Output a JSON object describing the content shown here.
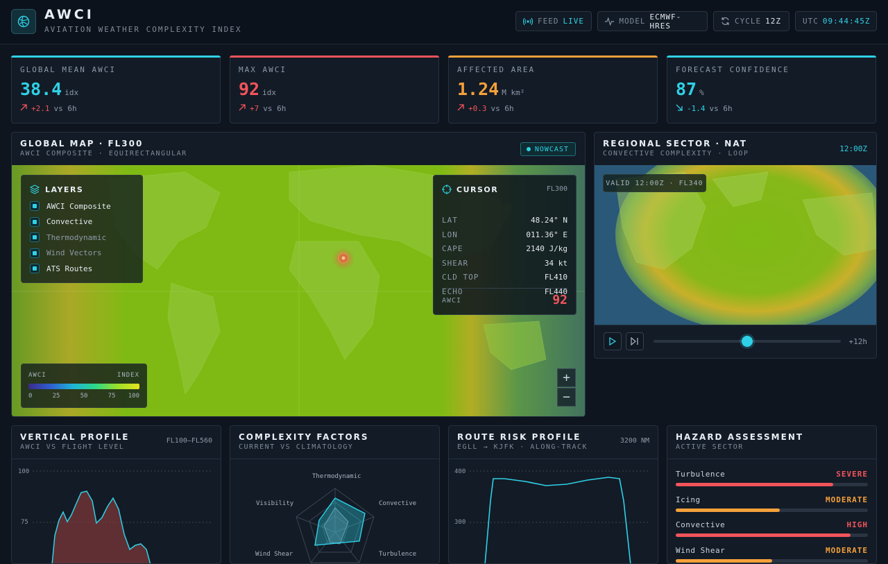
{
  "header": {
    "title": "AWCI",
    "subtitle": "AVIATION WEATHER COMPLEXITY INDEX",
    "feed": {
      "label": "FEED",
      "value": "LIVE"
    },
    "model": {
      "label": "MODEL",
      "value": "ECMWF-HRES"
    },
    "cycle": {
      "label": "CYCLE",
      "value": "12Z"
    },
    "utc": {
      "label": "UTC",
      "value": "09:44:45Z"
    }
  },
  "stats": [
    {
      "label": "GLOBAL MEAN AWCI",
      "value": "38.4",
      "unit": "idx",
      "delta": "+2.1",
      "suffix": "vs 6h",
      "color": "#2fd1e6",
      "delta_color": "#f2545b"
    },
    {
      "label": "MAX AWCI",
      "value": "92",
      "unit": "idx",
      "delta": "+7",
      "suffix": "vs 6h",
      "color": "#f2545b",
      "delta_color": "#f2545b"
    },
    {
      "label": "AFFECTED AREA",
      "value": "1.24",
      "unit": "M km²",
      "delta": "+0.3",
      "suffix": "vs 6h",
      "color": "#f5a03a",
      "delta_color": "#f2545b"
    },
    {
      "label": "FORECAST CONFIDENCE",
      "value": "87",
      "unit": "%",
      "delta": "-1.4",
      "suffix": "vs 6h",
      "color": "#2fd1e6",
      "delta_color": "#2fd1e6"
    }
  ],
  "map": {
    "title": "GLOBAL MAP · FL300",
    "subtitle": "AWCI COMPOSITE · EQUIRECTANGULAR",
    "badge": "NOWCAST",
    "layers_title": "LAYERS",
    "layers": [
      {
        "label": "AWCI Composite",
        "on": true
      },
      {
        "label": "Convective",
        "on": true
      },
      {
        "label": "Thermodynamic",
        "on": false
      },
      {
        "label": "Wind Vectors",
        "on": false
      },
      {
        "label": "ATS Routes",
        "on": true
      }
    ],
    "legend": {
      "left": "AWCI",
      "right": "INDEX",
      "ticks": [
        "0",
        "25",
        "50",
        "75",
        "100"
      ]
    },
    "cursor": {
      "title": "CURSOR",
      "level": "FL300",
      "rows": [
        {
          "k": "LAT",
          "v": "48.24° N"
        },
        {
          "k": "LON",
          "v": "011.36° E"
        },
        {
          "k": "CAPE",
          "v": "2140 J/kg"
        },
        {
          "k": "SHEAR",
          "v": "34 kt"
        },
        {
          "k": "CLD TOP",
          "v": "FL410"
        },
        {
          "k": "ECHO",
          "v": "FL440"
        }
      ],
      "awci_label": "AWCI",
      "awci_value": "92"
    },
    "zoom_in": "+",
    "zoom_out": "−"
  },
  "regional": {
    "title": "REGIONAL SECTOR · NAT",
    "subtitle": "CONVECTIVE COMPLEXITY · LOOP",
    "time": "12:00Z",
    "valid": "VALID 12:00Z · FL340",
    "end_label": "+12h",
    "progress": 0.5
  },
  "vertical": {
    "title": "VERTICAL PROFILE",
    "subtitle": "AWCI VS FLIGHT LEVEL",
    "range": "FL100–FL560",
    "ticks": [
      "100",
      "75"
    ]
  },
  "factors": {
    "title": "COMPLEXITY FACTORS",
    "subtitle": "CURRENT VS CLIMATOLOGY",
    "axes": [
      "Thermodynamic",
      "Convective",
      "Turbulence",
      "Wind Shear",
      "Visibility"
    ]
  },
  "route": {
    "title": "ROUTE RISK PROFILE",
    "subtitle": "EGLL → KJFK · ALONG-TRACK",
    "distance": "3200 NM",
    "ticks": [
      "400",
      "300"
    ]
  },
  "hazard": {
    "title": "HAZARD ASSESSMENT",
    "subtitle": "ACTIVE SECTOR",
    "rows": [
      {
        "name": "Turbulence",
        "level": "SEVERE",
        "color": "#f2545b",
        "fraction": 0.82
      },
      {
        "name": "Icing",
        "level": "MODERATE",
        "color": "#f5a03a",
        "fraction": 0.54
      },
      {
        "name": "Convective",
        "level": "HIGH",
        "color": "#f2545b",
        "fraction": 0.91
      },
      {
        "name": "Wind Shear",
        "level": "MODERATE",
        "color": "#f5a03a",
        "fraction": 0.5
      }
    ]
  }
}
